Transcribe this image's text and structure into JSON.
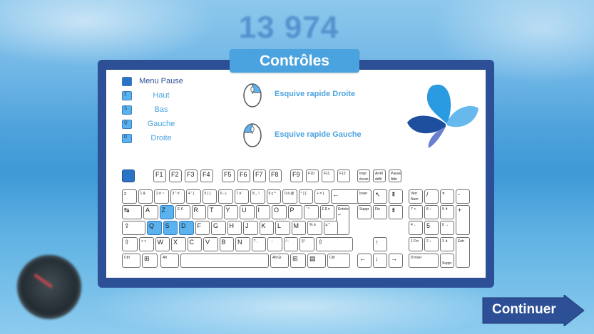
{
  "score": "13 974",
  "title": "Contrôles",
  "legend": [
    {
      "key": "",
      "label": "Menu Pause",
      "dark": true
    },
    {
      "key": "Z",
      "label": "Haut"
    },
    {
      "key": "S",
      "label": "Bas"
    },
    {
      "key": "Q",
      "label": "Gauche"
    },
    {
      "key": "D",
      "label": "Droite"
    }
  ],
  "mouse_actions": [
    {
      "label": "Esquive rapide Droite",
      "icon": "mouse-right-click-icon"
    },
    {
      "label": "Esquive rapide Gauche",
      "icon": "mouse-left-click-icon"
    }
  ],
  "logo": "butterfly-logo-icon",
  "continue_label": "Continuer",
  "colors": {
    "panel": "#2d4f96",
    "accent": "#4aa3df",
    "highlight": "#5ab2ef",
    "dark_key": "#2a73c5"
  },
  "keyboard": {
    "fn_row": [
      {
        "m": "",
        "dk": true
      },
      {
        "m": "F1"
      },
      {
        "m": "F2"
      },
      {
        "m": "F3"
      },
      {
        "m": "F4"
      },
      {
        "m": "F5"
      },
      {
        "m": "F6"
      },
      {
        "m": "F7"
      },
      {
        "m": "F8"
      },
      {
        "m": "F9"
      },
      {
        "m": "F10"
      },
      {
        "m": "F11"
      },
      {
        "m": "F12"
      },
      {
        "m": "Impr écran Syst"
      },
      {
        "m": "Arrêt défil"
      },
      {
        "m": "Pause Attn"
      }
    ],
    "row1": [
      "²",
      "1 &",
      "2 é ~",
      "3 \" #",
      "4 ' {",
      "5 ( [",
      "6 - |",
      "7 è `",
      "8 _ \\",
      "9 ç ^",
      "0 à @",
      "° ) ]",
      "+ = }",
      "←"
    ],
    "row2": [
      "↹",
      "A",
      "Z",
      "E €",
      "R",
      "T",
      "Y",
      "U",
      "I",
      "O",
      "P",
      "¨ ^",
      "£ $ ¤",
      "Entrée ↵"
    ],
    "row3": [
      "⇪",
      "Q",
      "S",
      "D",
      "F",
      "G",
      "H",
      "J",
      "K",
      "L",
      "M",
      "% ù",
      "µ *"
    ],
    "row4": [
      "⇧",
      "> <",
      "W",
      "X",
      "C",
      "V",
      "B",
      "N",
      "? ,",
      ". ;",
      "/ :",
      "§ !",
      "⇧"
    ],
    "row5": [
      "Ctrl",
      "⊞",
      "Alt",
      "",
      "Alt Gr",
      "⊞",
      "▤",
      "Ctrl"
    ],
    "nav_top": [
      "Inser",
      "↖",
      "⇞",
      "Suppr",
      "Fin",
      "⇟"
    ],
    "arrows": [
      "↑",
      "←",
      "↓",
      "→"
    ],
    "numpad": [
      "Verr Num",
      "/",
      "*",
      "-",
      "7 ↖",
      "8 ↑",
      "9 ⇞",
      "+",
      "4 ←",
      "5",
      "6 →",
      "1 Fin",
      "2 ↓",
      "3 ⇟",
      "Entr",
      "0 Inser",
      ". Suppr"
    ]
  }
}
